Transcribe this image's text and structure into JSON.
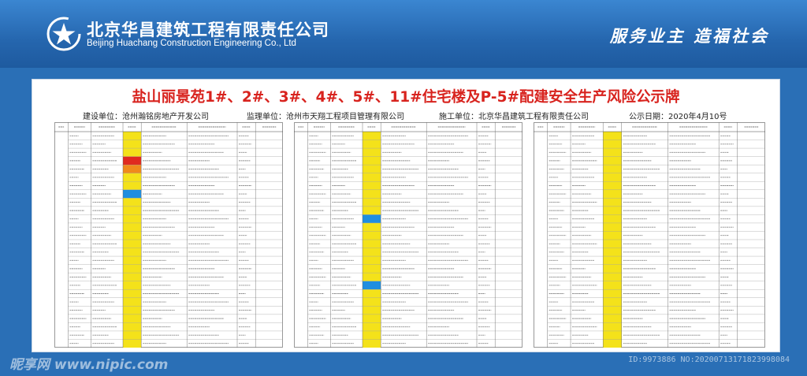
{
  "header": {
    "company_cn": "北京华昌建筑工程有限责任公司",
    "company_en": "Beijing Huachang Construction Engineering Co., Ltd",
    "slogan": "服务业主 造福社会",
    "logo_icon": "star-circle-logo-icon"
  },
  "board": {
    "title": "盐山丽景苑1#、2#、3#、4#、5#、11#住宅楼及P-5#配建安全生产风险公示牌",
    "info": {
      "builder": "建设单位：沧州瀚铭房地产开发公司",
      "supervisor": "监理单位：沧州市天翔工程项目管理有限公司",
      "contractor": "施工单位：北京华昌建筑工程有限责任公司",
      "date": "公示日期：2020年4月10号"
    }
  },
  "risk_colors": {
    "major": "#e02a1f",
    "large": "#f08a1c",
    "general": "#f4e21a",
    "low": "#1f8ee0"
  },
  "tables": [
    {
      "rows": 26,
      "levels": [
        "general",
        "general",
        "general",
        "major",
        "large",
        "general",
        "general",
        "low",
        "general",
        "general",
        "general",
        "general",
        "general",
        "general",
        "general",
        "general",
        "general",
        "general",
        "general",
        "general",
        "general",
        "general",
        "general",
        "general",
        "general",
        "general"
      ]
    },
    {
      "rows": 26,
      "levels": [
        "general",
        "general",
        "general",
        "general",
        "general",
        "general",
        "general",
        "general",
        "general",
        "general",
        "low",
        "general",
        "general",
        "general",
        "general",
        "general",
        "general",
        "general",
        "low",
        "general",
        "general",
        "general",
        "general",
        "general",
        "general",
        "general"
      ]
    },
    {
      "rows": 26,
      "levels": [
        "general",
        "general",
        "general",
        "general",
        "general",
        "general",
        "general",
        "general",
        "general",
        "general",
        "general",
        "general",
        "general",
        "general",
        "general",
        "general",
        "general",
        "general",
        "general",
        "general",
        "general",
        "general",
        "general",
        "general",
        "general",
        "general"
      ]
    }
  ],
  "footer": {
    "watermark": "昵享网 www.nipic.com",
    "image_id": "ID:9973886 NO:20200713171823998084"
  }
}
